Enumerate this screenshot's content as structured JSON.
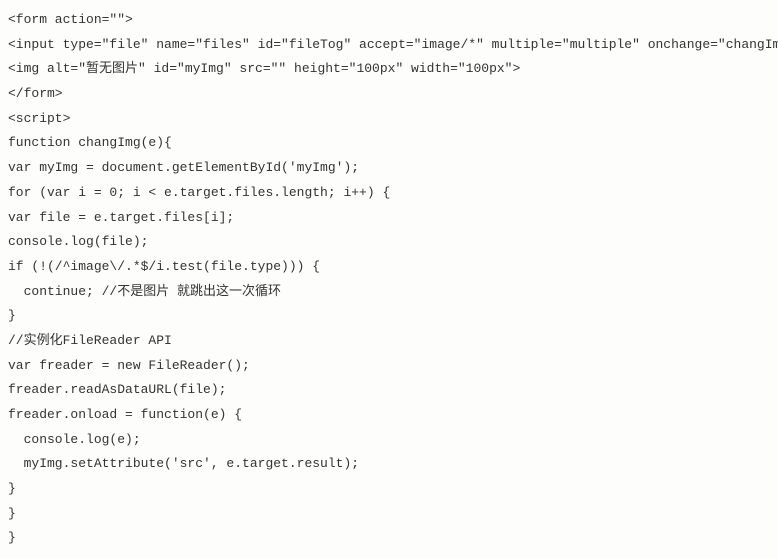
{
  "code_lines": [
    "<form action=\"\">",
    "<input type=\"file\" name=\"files\" id=\"fileTog\" accept=\"image/*\" multiple=\"multiple\" onchange=\"changImg(event)\">",
    "<img alt=\"暂无图片\" id=\"myImg\" src=\"\" height=\"100px\" width=\"100px\">",
    "</form>",
    "<script>",
    "function changImg(e){",
    "var myImg = document.getElementById('myImg');",
    "for (var i = 0; i < e.target.files.length; i++) {",
    "var file = e.target.files[i];",
    "console.log(file);",
    "if (!(/^image\\/.*$/i.test(file.type))) {",
    "  continue; //不是图片 就跳出这一次循环",
    "}",
    "//实例化FileReader API",
    "var freader = new FileReader();",
    "freader.readAsDataURL(file);",
    "freader.onload = function(e) {",
    "  console.log(e);",
    "  myImg.setAttribute('src', e.target.result);",
    "}",
    "}",
    "}"
  ]
}
